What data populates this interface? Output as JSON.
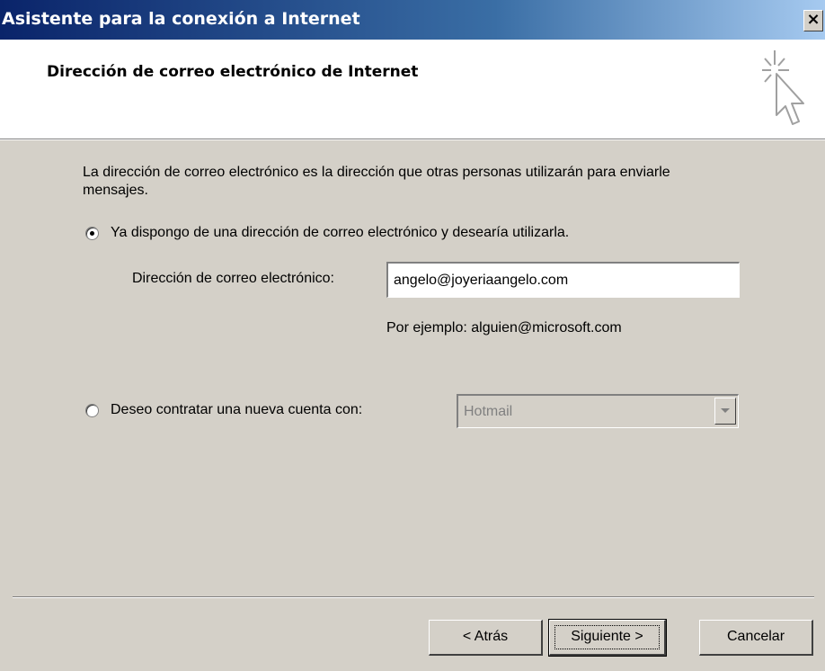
{
  "window": {
    "title": "Asistente para la conexión a Internet",
    "close_label": "×"
  },
  "header": {
    "title": "Dirección de correo electrónico de Internet",
    "icon": "wizard-cursor-icon"
  },
  "body": {
    "description": "La dirección de correo electrónico es la dirección que otras personas utilizarán para enviarle mensajes.",
    "option_existing": {
      "label": "Ya dispongo de una dirección de correo electrónico y desearía utilizarla.",
      "selected": true
    },
    "email_label": "Dirección de correo electrónico:",
    "email_value": "angelo@joyeriaangelo.com",
    "example": "Por ejemplo: alguien@microsoft.com",
    "option_new": {
      "label": "Deseo contratar una nueva cuenta con:",
      "selected": false
    },
    "provider_value": "Hotmail"
  },
  "buttons": {
    "back": "< Atrás",
    "next": "Siguiente >",
    "cancel": "Cancelar"
  },
  "colors": {
    "dialog_bg": "#d4d0c8",
    "title_gradient_start": "#0a246a",
    "title_gradient_end": "#a6caf0",
    "disabled_text": "#808080"
  }
}
